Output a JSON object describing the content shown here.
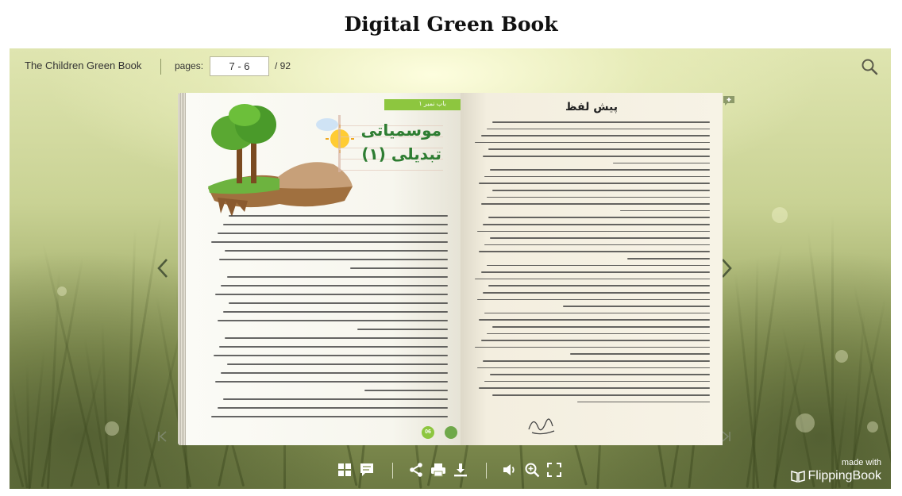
{
  "page_title": "Digital Green Book",
  "topbar": {
    "book_name": "The Children Green Book",
    "pages_label": "pages:",
    "page_value": "7 - 6",
    "pages_total": "/  92"
  },
  "left_page": {
    "chapter_tab": "باب نمبر ۱",
    "chapter_title": "موسمیاتی تبدیلی (۱)",
    "page_number": "06"
  },
  "right_page": {
    "heading": "پیش لفظ"
  },
  "branding": {
    "made_with": "made with",
    "brand": "FlippingBook"
  },
  "icons": {
    "search": "search-icon",
    "prev": "chevron-left-icon",
    "next": "chevron-right-icon",
    "first": "first-page-icon",
    "last": "last-page-icon",
    "bookmark": "bookmark-add-icon",
    "thumbnails": "thumbnails-icon",
    "notes": "notes-icon",
    "share": "share-icon",
    "print": "print-icon",
    "download": "download-icon",
    "sound": "sound-icon",
    "zoom": "zoom-in-icon",
    "fullscreen": "fullscreen-icon"
  },
  "colors": {
    "accent_green": "#8dc63f",
    "title_green": "#2e7d32"
  }
}
